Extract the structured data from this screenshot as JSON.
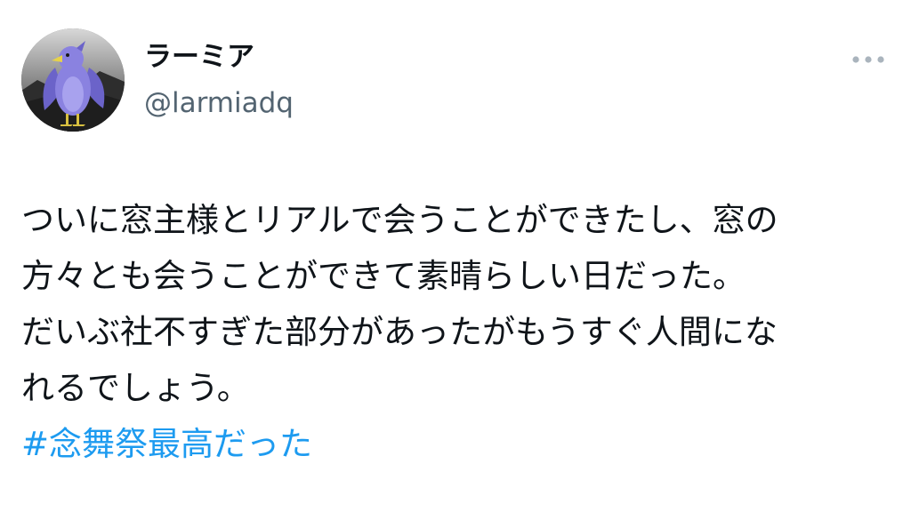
{
  "user": {
    "display_name": "ラーミア",
    "handle": "@larmiadq",
    "avatar_icon": "purple-bird-avatar-icon"
  },
  "menu": {
    "icon": "more-options-icon"
  },
  "tweet": {
    "lines": [
      "ついに窓主様とリアルで会うことができたし、窓の",
      "方々とも会うことができて素晴らしい日だった。",
      "だいぶ社不すぎた部分があったがもうすぐ人間にな",
      "れるでしょう。"
    ],
    "hashtag": "#念舞祭最高だった"
  },
  "colors": {
    "text": "#0f1419",
    "secondary_text": "#536471",
    "link": "#1d9bf0",
    "background": "#ffffff"
  }
}
